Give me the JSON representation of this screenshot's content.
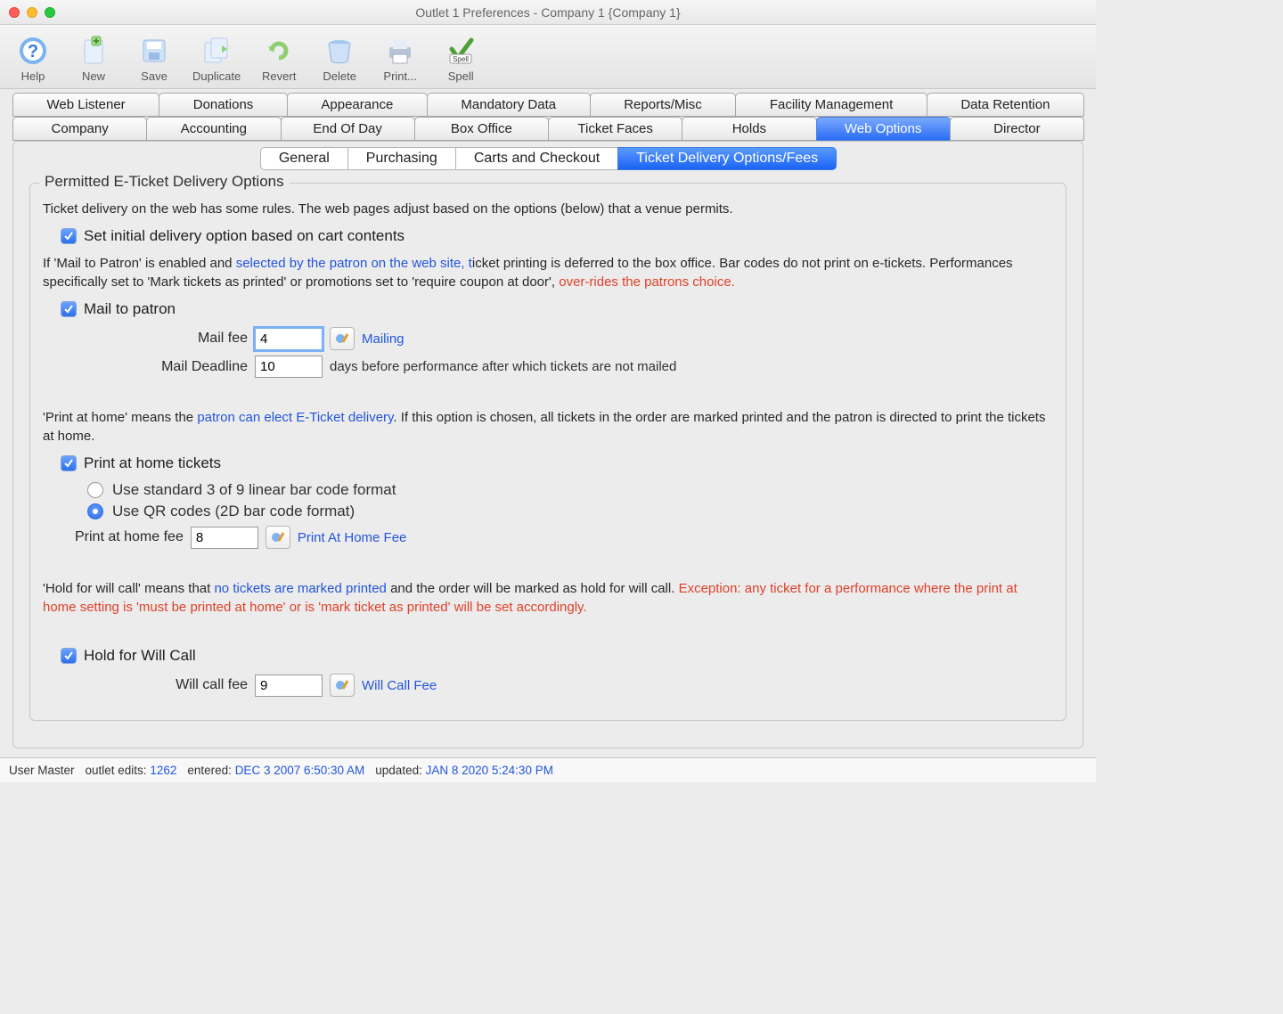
{
  "window": {
    "title": "Outlet 1 Preferences - Company 1 {Company 1}"
  },
  "toolbar": {
    "help": "Help",
    "new": "New",
    "save": "Save",
    "duplicate": "Duplicate",
    "revert": "Revert",
    "delete": "Delete",
    "print": "Print...",
    "spell": "Spell"
  },
  "tabs1": {
    "web_listener": "Web Listener",
    "donations": "Donations",
    "appearance": "Appearance",
    "mandatory_data": "Mandatory Data",
    "reports_misc": "Reports/Misc",
    "facility_management": "Facility Management",
    "data_retention": "Data Retention"
  },
  "tabs2": {
    "company": "Company",
    "accounting": "Accounting",
    "end_of_day": "End Of Day",
    "box_office": "Box Office",
    "ticket_faces": "Ticket Faces",
    "holds": "Holds",
    "web_options": "Web Options",
    "director": "Director"
  },
  "subtabs": {
    "general": "General",
    "purchasing": "Purchasing",
    "carts": "Carts and Checkout",
    "ticket_delivery": "Ticket Delivery Options/Fees"
  },
  "fieldset": {
    "legend": "Permitted E-Ticket Delivery Options",
    "intro": "Ticket delivery on the web has some rules.  The web pages adjust based on the options (below) that a venue permits.",
    "set_initial": "Set initial delivery option based on cart contents",
    "mail_p1_a": "If 'Mail to Patron' is enabled and ",
    "mail_p1_link": "selected by the patron on the web site, t",
    "mail_p1_b": "icket printing is deferred to the box office.   Bar codes do not print on e-tickets.  Performances specifically set to 'Mark tickets as printed' or promotions set to 'require coupon at door', ",
    "mail_p1_warn": "over-rides the patrons choice.",
    "mail_to_patron": "Mail to patron",
    "mail_fee_label": "Mail fee",
    "mail_fee_value": "4",
    "mailing_link": "Mailing",
    "mail_deadline_label": "Mail Deadline",
    "mail_deadline_value": "10",
    "mail_deadline_suffix": "days before performance after which tickets are not mailed",
    "print_p1_a": "'Print at home' means the ",
    "print_p1_link": "patron can elect E-Ticket delivery",
    "print_p1_b": ".  If this option is chosen, all tickets in the order are marked printed and the patron is directed to print the tickets at home.",
    "print_at_home": "Print at home tickets",
    "radio_3of9": "Use standard 3 of 9 linear bar code format",
    "radio_qr": "Use QR codes (2D bar code format)",
    "print_fee_label": "Print at home fee",
    "print_fee_value": "8",
    "print_fee_link": "Print At Home Fee",
    "hold_p1_a": "'Hold for will call' means that ",
    "hold_p1_link": "no tickets are marked printed",
    "hold_p1_b": " and the order will be marked as hold for will call. ",
    "hold_p1_warn": "Exception: any ticket for a performance where the print at home setting is 'must be printed at home' or is 'mark ticket as printed' will be set accordingly.",
    "hold_for_will_call": "Hold for Will Call",
    "will_call_fee_label": "Will call fee",
    "will_call_fee_value": "9",
    "will_call_fee_link": "Will Call Fee"
  },
  "status": {
    "user": "User Master",
    "edits_label": "outlet edits:",
    "edits_val": "1262",
    "entered_label": "entered:",
    "entered_val": "DEC 3 2007 6:50:30 AM",
    "updated_label": "updated:",
    "updated_val": "JAN 8 2020 5:24:30 PM"
  }
}
